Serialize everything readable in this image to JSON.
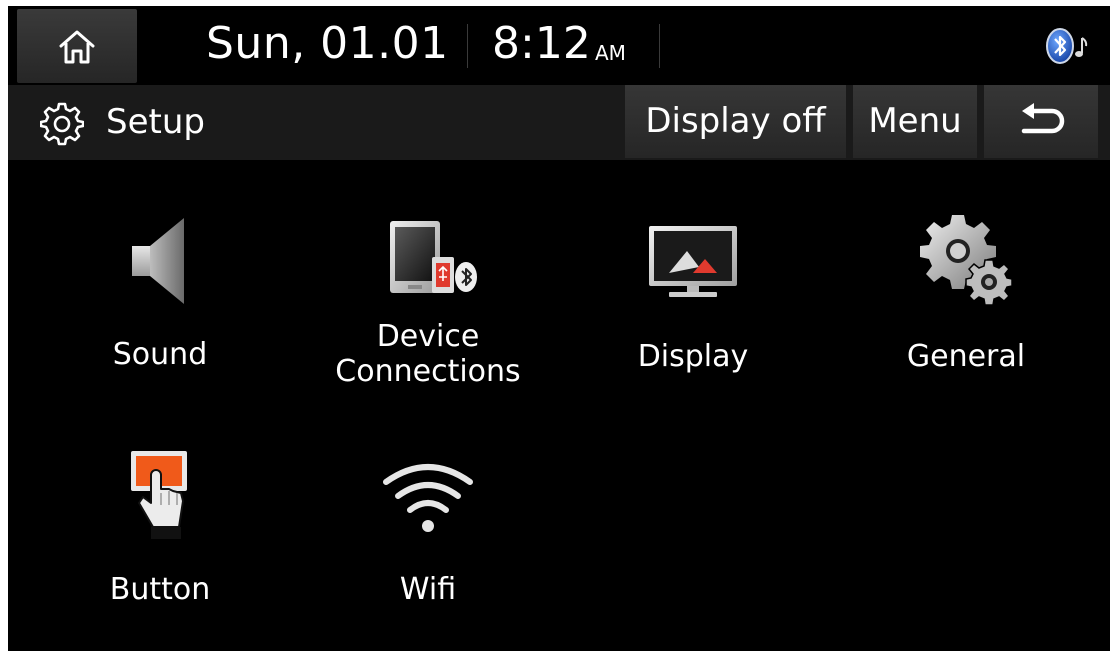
{
  "status_bar": {
    "date": "Sun, 01.01",
    "time": "8:12",
    "meridiem": "AM",
    "home_icon": "home-icon",
    "bluetooth_icon": "bluetooth-audio-icon"
  },
  "header": {
    "title": "Setup",
    "title_icon": "gear-icon",
    "display_off_label": "Display off",
    "menu_label": "Menu",
    "back_icon": "back-arrow-icon"
  },
  "menu_items": [
    {
      "label": "Sound",
      "icon": "speaker-icon"
    },
    {
      "label": "Device\nConnections",
      "label_line1": "Device",
      "label_line2": "Connections",
      "icon": "device-connections-icon"
    },
    {
      "label": "Display",
      "icon": "monitor-icon"
    },
    {
      "label": "General",
      "icon": "gears-icon"
    },
    {
      "label": "Button",
      "icon": "button-press-icon"
    },
    {
      "label": "Wifi",
      "icon": "wifi-icon"
    }
  ],
  "colors": {
    "background": "#000000",
    "title_bar": "#1a1a1a",
    "accent_red": "#e03a2e",
    "button_orange": "#f05a1a",
    "bluetooth_blue": "#2e6fd6"
  }
}
